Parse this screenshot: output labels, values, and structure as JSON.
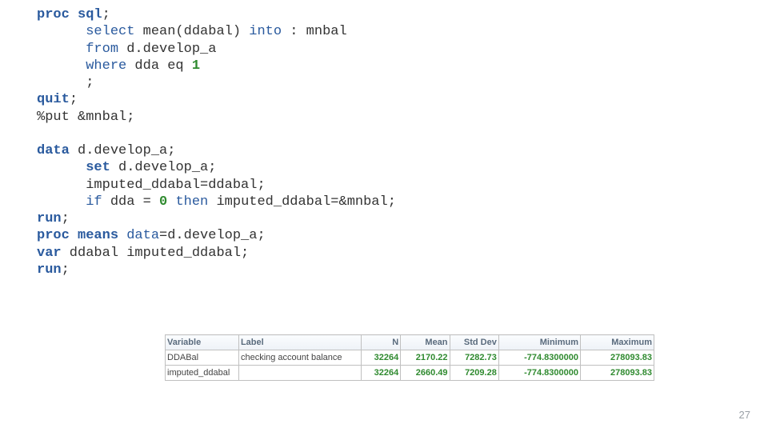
{
  "code": {
    "l1a": "proc sql",
    "l1b": ";",
    "l2a": "      select",
    "l2b": " mean(ddabal) ",
    "l2c": "into",
    "l2d": " : mnbal",
    "l3a": "      from",
    "l3b": " d.develop_a",
    "l4a": "      where",
    "l4b": " dda eq ",
    "l4c": "1",
    "l5": "      ;",
    "l6a": "quit",
    "l6b": ";",
    "l7": "%put &mnbal;",
    "blank1": " ",
    "l8a": "data",
    "l8b": " d.develop_a;",
    "l9a": "      set",
    "l9b": " d.develop_a;",
    "l10": "      imputed_ddabal=ddabal;",
    "l11a": "      if",
    "l11b": " dda = ",
    "l11c": "0",
    "l11d": " ",
    "l11e": "then",
    "l11f": " imputed_ddabal=&mnbal;",
    "l12a": "run",
    "l12b": ";",
    "l13a": "proc means ",
    "l13b": "data",
    "l13c": "=d.develop_a;",
    "l14a": "var",
    "l14b": " ddabal imputed_ddabal;",
    "l15a": "run",
    "l15b": ";"
  },
  "table": {
    "headers": {
      "variable": "Variable",
      "label": "Label",
      "n": "N",
      "mean": "Mean",
      "std": "Std Dev",
      "min": "Minimum",
      "max": "Maximum"
    },
    "rows": [
      {
        "variable": "DDABal",
        "label": "checking account balance",
        "n": "32264",
        "mean": "2170.22",
        "std": "7282.73",
        "min": "-774.8300000",
        "max": "278093.83"
      },
      {
        "variable": "imputed_ddabal",
        "label": "",
        "n": "32264",
        "mean": "2660.49",
        "std": "7209.28",
        "min": "-774.8300000",
        "max": "278093.83"
      }
    ]
  },
  "page_number": "27"
}
